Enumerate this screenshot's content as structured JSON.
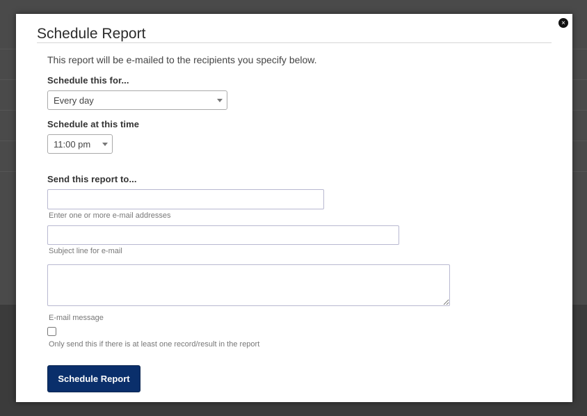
{
  "dialog": {
    "title": "Schedule Report",
    "close_glyph": "×",
    "intro": "This report will be e-mailed to the recipients you specify below."
  },
  "schedule_for": {
    "label": "Schedule this for...",
    "value": "Every day"
  },
  "schedule_time": {
    "label": "Schedule at this time",
    "value": "11:00 pm"
  },
  "send_to": {
    "label": "Send this report to...",
    "recipients_value": "",
    "recipients_hint": "Enter one or more e-mail addresses",
    "subject_value": "",
    "subject_hint": "Subject line for e-mail",
    "message_value": "",
    "message_hint": "E-mail message"
  },
  "only_if_results": {
    "checked": false,
    "label": "Only send this if there is at least one record/result in the report"
  },
  "submit_label": "Schedule Report",
  "icons": [
    "close-icon",
    "chevron-down-icon"
  ],
  "colors": {
    "primary_button": "#0a2f6b",
    "overlay": "#4a4a4a"
  }
}
